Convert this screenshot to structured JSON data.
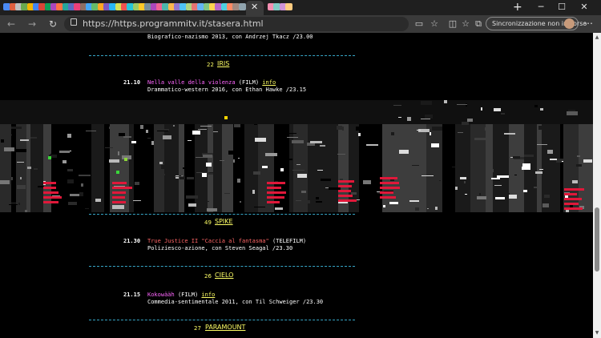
{
  "browser": {
    "url": "https://https.programmitv.it/stasera.html",
    "sync_label": "Sincronizzazione non in corso",
    "tab_favicons": [
      "#4a8af4",
      "#e06040",
      "#c0c0c0",
      "#6aa84f",
      "#f4b400",
      "#4285f4",
      "#db4437",
      "#0f9d58",
      "#ab47bc",
      "#ff7043",
      "#26a69a",
      "#5c6bc0",
      "#ec407a",
      "#8d6e63",
      "#42a5f5",
      "#66bb6a",
      "#ffa726",
      "#7e57c2",
      "#29b6f6",
      "#d4e157",
      "#ef5350",
      "#26c6da",
      "#9ccc65",
      "#ffca28",
      "#78909c",
      "#ab47bc",
      "#f06292",
      "#4db6ac",
      "#ffb74d",
      "#9575cd",
      "#4fc3f7",
      "#aed581",
      "#e57373",
      "#64b5f6",
      "#81c784",
      "#ffd54f",
      "#ba68c8",
      "#4dd0e1",
      "#ff8a65",
      "#a1887f",
      "#90a4ae",
      "#f48fb1",
      "#80cbc4",
      "#ce93d8",
      "#ffcc80"
    ]
  },
  "programs": {
    "prev_desc": "Biografico-nazismo 2013, con Andrzej Tkacz /23.00",
    "iris": {
      "channel_num": "22",
      "channel_name": "IRIS",
      "time": "21.10",
      "title": "Nella valle della violenza",
      "tag": "(FILM)",
      "info": "info",
      "desc": "Drammatico-western 2016, con Ethan Hawke /23.15"
    },
    "spike": {
      "channel_num": "49",
      "channel_name": "SPIKE",
      "time": "21.30",
      "title": "True Justice II \"Caccia al fantasma\"",
      "tag": "(TELEFILM)",
      "desc": "Poliziesco-azione, con Steven Seagal /23.30"
    },
    "cielo": {
      "channel_num": "26",
      "channel_name": "CIELO",
      "time": "21.15",
      "title": "Kokowääh",
      "tag": "(FILM)",
      "info": "info",
      "desc": "Commedia-sentimentale 2011, con Til Schweiger /23.30"
    },
    "paramount": {
      "channel_num": "27",
      "channel_name": "PARAMOUNT"
    }
  },
  "colors": {
    "separator": "#36a6c7",
    "channel": "#ffff66",
    "film_title": "#ff66ff",
    "telefilm_title": "#ff6666"
  }
}
